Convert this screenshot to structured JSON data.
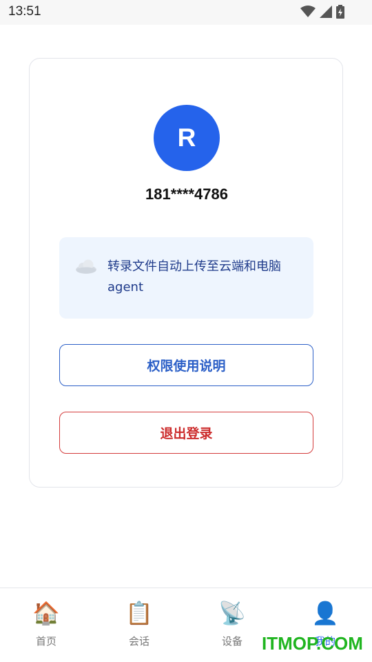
{
  "status_bar": {
    "time": "13:51",
    "icons": [
      "wifi-icon",
      "cell-signal-icon",
      "battery-charging-icon"
    ]
  },
  "profile": {
    "avatar_letter": "R",
    "phone": "181****4786",
    "accent_color": "#2563eb"
  },
  "info": {
    "icon": "cloud-icon",
    "text": "转录文件自动上传至云端和电脑agent"
  },
  "buttons": {
    "permissions": "权限使用说明",
    "logout": "退出登录"
  },
  "tabbar": {
    "items": [
      {
        "label": "首页",
        "icon": "🏠"
      },
      {
        "label": "会话",
        "icon": "📋"
      },
      {
        "label": "设备",
        "icon": "📡"
      },
      {
        "label": "我的",
        "icon": "👤",
        "active": true
      }
    ]
  },
  "watermark": "ITMOP.COM"
}
